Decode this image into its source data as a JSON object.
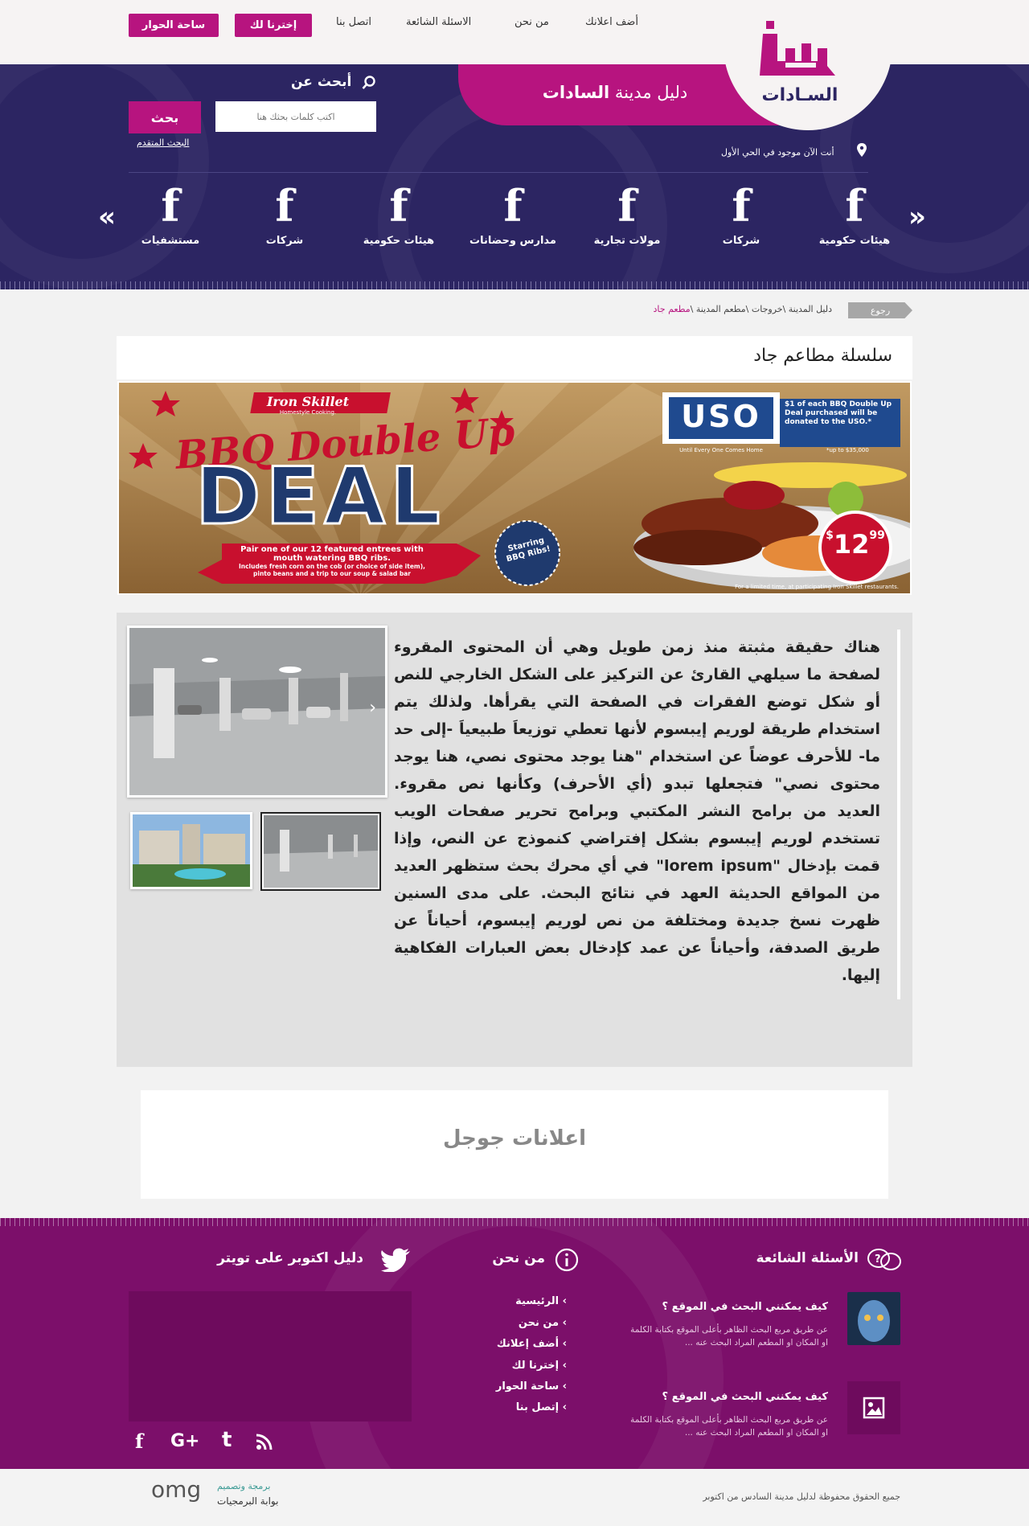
{
  "nav": {
    "links": [
      "أضف اعلانك",
      "من نحن",
      "الاسئلة الشائعة",
      "اتصل بنا"
    ],
    "btn_choose": "إخترنا لك",
    "btn_forum": "ساحة الحوار"
  },
  "logo": {
    "text": "السـادات"
  },
  "header": {
    "guide_prefix": "دليل مدينة",
    "guide_city": "السادات",
    "search_title": "أبحث عن",
    "search_placeholder": "اكتب كلمات بحثك هنا",
    "search_button": "بحث",
    "advanced_search": "البحث المتقدم",
    "location": "أنت الآن موجود في الحي الأول"
  },
  "categories": [
    {
      "label": "هيئات حكومية",
      "icon": "facebook-icon"
    },
    {
      "label": "شركات",
      "icon": "facebook-icon"
    },
    {
      "label": "مولات تجارية",
      "icon": "facebook-icon"
    },
    {
      "label": "مدارس وحضانات",
      "icon": "facebook-icon"
    },
    {
      "label": "هيئات حكومية",
      "icon": "facebook-icon"
    },
    {
      "label": "شركات",
      "icon": "facebook-icon"
    },
    {
      "label": "مستشفيات",
      "icon": "facebook-icon"
    }
  ],
  "breadcrumb": {
    "back": "رجوع",
    "trail": "دليل المدينة \\خروجات \\مطعم المدينة \\",
    "current": "مطعم جاد"
  },
  "page": {
    "title": "سلسلة مطاعم جاد"
  },
  "banner": {
    "brand": "Iron Skillet",
    "brand_sub": "Homestyle Cooking.",
    "headline": "BBQ Double Up",
    "deal": "DEAL",
    "ribbon_line1": "Pair one of our 12 featured entrees with",
    "ribbon_line2": "mouth watering BBQ ribs.",
    "ribbon_line3": "Includes fresh corn on the cob (or choice of side item),",
    "ribbon_line4": "pinto beans and a trip to our soup & salad bar",
    "uso": "USO",
    "uso_tag": "Until Every One Comes Home",
    "uso_note": "$1 of each BBQ Double Up Deal purchased will be donated to the USO.*",
    "uso_upto": "*up to $35,000",
    "starring": "Starring BBQ Ribs!",
    "price_dollar": "$",
    "price": "12",
    "price_cents": "99",
    "disclaimer": "For a limited time, at participating Iron Skillet restaurants."
  },
  "article": {
    "text": "هناك حقيقة مثبتة منذ زمن طويل وهي أن المحتوى المقروء لصفحة ما سيلهي القارئ عن التركيز على الشكل الخارجي للنص أو شكل توضع الفقرات في الصفحة التي يقرأها. ولذلك يتم استخدام طريقة لوريم إيبسوم لأنها تعطي توزيعاَ طبيعياَ -إلى حد ما- للأحرف عوضاً عن استخدام \"هنا يوجد محتوى نصي، هنا يوجد محتوى نصي\" فتجعلها تبدو (أي الأحرف) وكأنها نص مقروء. العديد من برامح النشر المكتبي وبرامح تحرير صفحات الويب تستخدم لوريم إيبسوم بشكل إفتراضي كنموذج عن النص، وإذا قمت بإدخال \"lorem ipsum\" في أي محرك بحث ستظهر العديد من المواقع الحديثة العهد في نتائج البحث. على مدى السنين ظهرت نسخ جديدة ومختلفة من نص لوريم إيبسوم، أحياناً عن طريق الصدفة، وأحياناً عن عمد كإدخال بعض العبارات الفكاهية إليها."
  },
  "ads": {
    "label": "اعلانات جوجل"
  },
  "footer": {
    "faq_title": "الأسئلة الشائعة",
    "faq": [
      {
        "q": "كيف يمكنني البحث في الموقع ؟",
        "a": "عن طريق مربع البحث الظاهر بأعلى الموقع بكتابة الكلمة او المكان او المطعم المراد البحث عنه ..."
      },
      {
        "q": "كيف يمكنني البحث في الموقع ؟",
        "a": "عن طريق مربع البحث الظاهر بأعلى الموقع بكتابة الكلمة او المكان او المطعم المراد البحث عنه ..."
      }
    ],
    "about_title": "من نحن",
    "links": [
      "الرئيسية",
      "من نحن",
      "أضف إعلانك",
      "إخترنا لك",
      "ساحة الحوار",
      "إتصل بنا"
    ],
    "twitter_title": "دليل اكتوبر على تويتر",
    "social": [
      "facebook-icon",
      "google-plus-icon",
      "tumblr-icon",
      "rss-icon"
    ],
    "social_glyphs": [
      "f",
      "G+",
      "t",
      ""
    ],
    "copyright": "جميع الحقوق محفوظة لدليل مدينة السادس من اكتوبر",
    "credit_line1": "برمجة وتصميم",
    "credit_line2": "بوابة البرمجيات",
    "credit_logo": "omg",
    "chevron": "›"
  },
  "colors": {
    "brand_pink": "#b7147f",
    "header_navy": "#2c2562",
    "footer_purple": "#7c0f6a"
  }
}
